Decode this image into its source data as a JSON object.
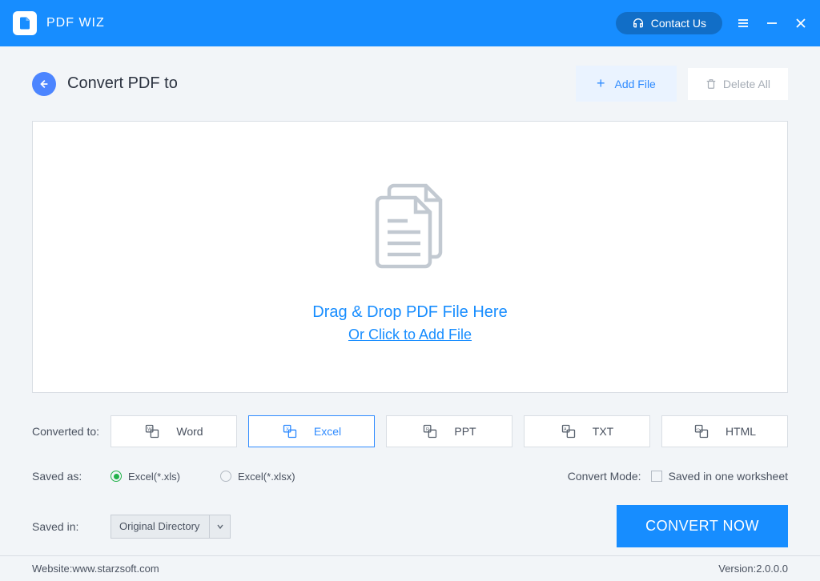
{
  "titlebar": {
    "app_name": "PDF WIZ",
    "contact_label": "Contact Us"
  },
  "header": {
    "page_title": "Convert PDF to",
    "add_file_label": "Add File",
    "delete_all_label": "Delete All"
  },
  "drop": {
    "drag_text": "Drag & Drop PDF File Here",
    "click_text": "Or Click to Add File"
  },
  "converted_to": {
    "label": "Converted to:",
    "formats": [
      {
        "name": "Word",
        "active": false
      },
      {
        "name": "Excel",
        "active": true
      },
      {
        "name": "PPT",
        "active": false
      },
      {
        "name": "TXT",
        "active": false
      },
      {
        "name": "HTML",
        "active": false
      }
    ]
  },
  "saved_as": {
    "label": "Saved as:",
    "options": [
      {
        "label": "Excel(*.xls)",
        "selected": true
      },
      {
        "label": "Excel(*.xlsx)",
        "selected": false
      }
    ]
  },
  "convert_mode": {
    "label": "Convert Mode:",
    "checkbox_label": "Saved in one worksheet",
    "checked": false
  },
  "saved_in": {
    "label": "Saved in:",
    "selected": "Original Directory"
  },
  "convert_button": "CONVERT NOW",
  "footer": {
    "website_label": "Website: ",
    "website_value": "www.starzsoft.com",
    "version_label": "Version: ",
    "version_value": "2.0.0.0"
  }
}
